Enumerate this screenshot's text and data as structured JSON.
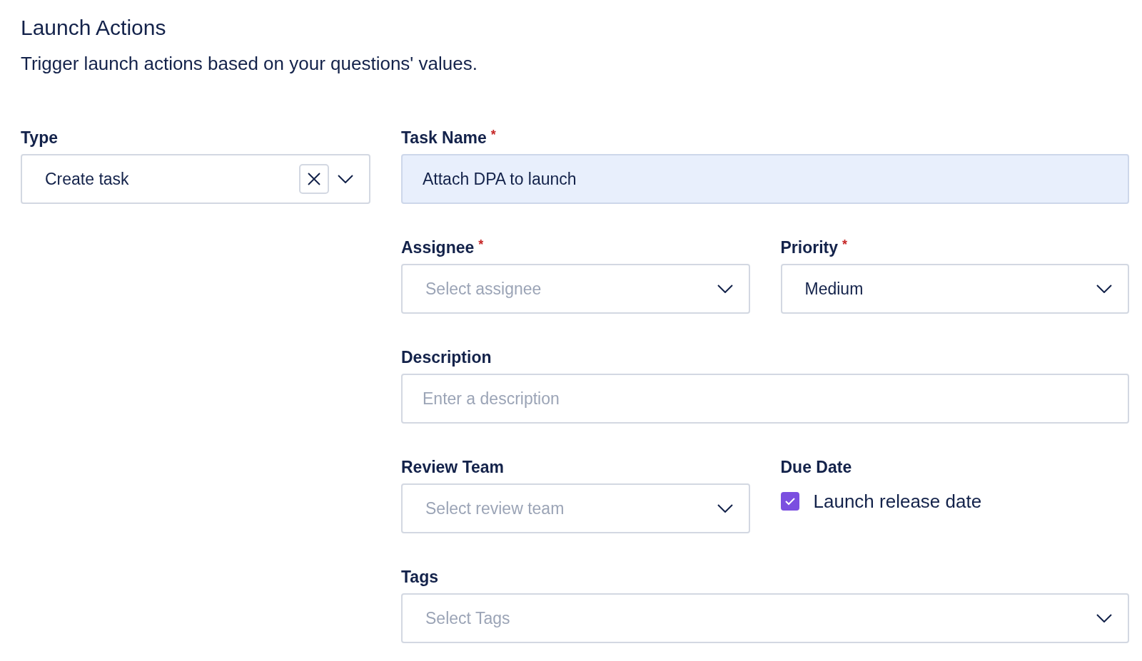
{
  "header": {
    "title": "Launch Actions",
    "subtitle": "Trigger launch actions based on your questions' values."
  },
  "left": [
    {
      "kind": "select",
      "label": "Type",
      "value": "Create task",
      "clearable": true
    }
  ],
  "right": [
    [
      {
        "kind": "text",
        "label": "Task Name",
        "required_mark": "*",
        "value": "Attach DPA to launch",
        "highlighted": true
      }
    ],
    [
      {
        "kind": "select",
        "label": "Assignee",
        "required_mark": "*",
        "placeholder": "Select assignee"
      },
      {
        "kind": "select",
        "label": "Priority",
        "required_mark": "*",
        "value": "Medium"
      }
    ],
    [
      {
        "kind": "text",
        "label": "Description",
        "placeholder": "Enter a description"
      }
    ],
    [
      {
        "kind": "select",
        "label": "Review Team",
        "placeholder": "Select review team"
      },
      {
        "kind": "checkbox",
        "label": "Due Date",
        "option": "Launch release date",
        "checked": true
      }
    ],
    [
      {
        "kind": "select",
        "label": "Tags",
        "placeholder": "Select Tags"
      }
    ]
  ]
}
